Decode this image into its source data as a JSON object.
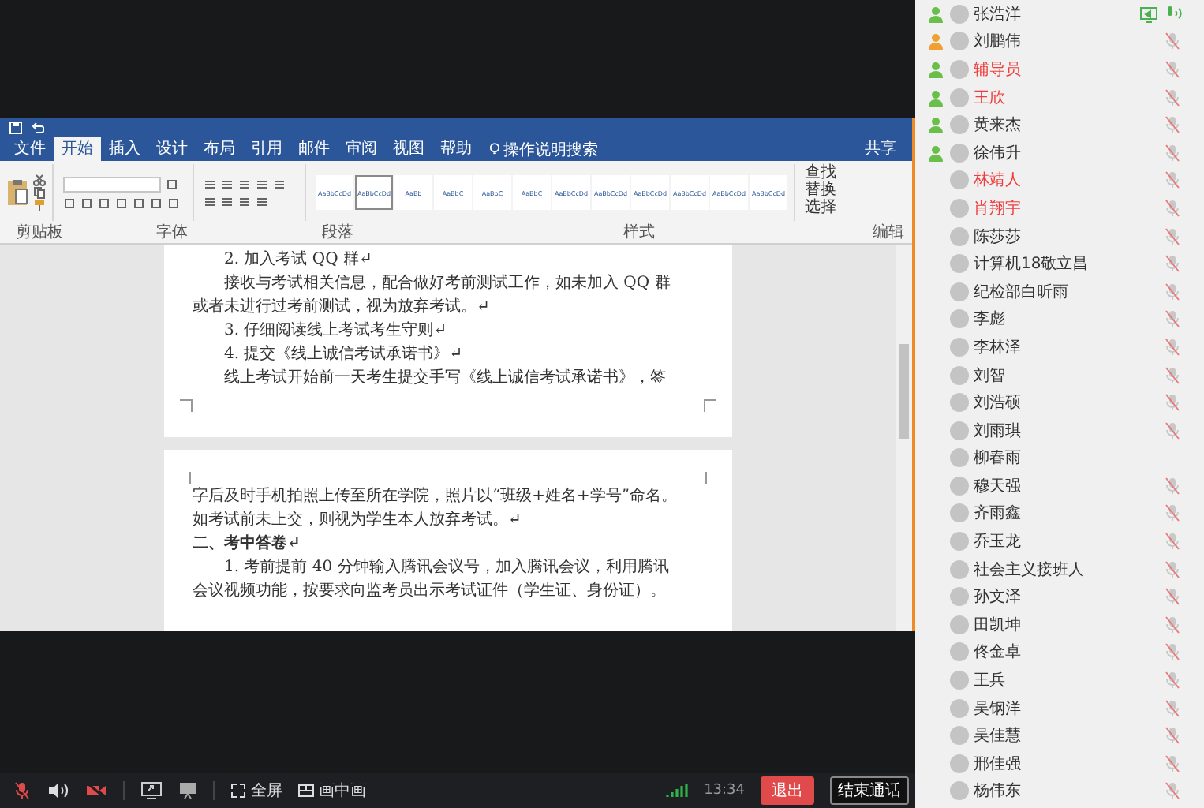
{
  "word": {
    "tabs": [
      {
        "label": "文件",
        "selected": false
      },
      {
        "label": "开始",
        "selected": true
      },
      {
        "label": "插入",
        "selected": false
      },
      {
        "label": "设计",
        "selected": false
      },
      {
        "label": "布局",
        "selected": false
      },
      {
        "label": "引用",
        "selected": false
      },
      {
        "label": "邮件",
        "selected": false
      },
      {
        "label": "审阅",
        "selected": false
      },
      {
        "label": "视图",
        "selected": false
      },
      {
        "label": "帮助",
        "selected": false
      }
    ],
    "tell_me": "操作说明搜索",
    "share": "共享",
    "styles": [
      {
        "preview": "AaBbCcDd",
        "selected": false
      },
      {
        "preview": "AaBbCcDd",
        "selected": true
      },
      {
        "preview": "AaBb",
        "selected": false
      },
      {
        "preview": "AaBbC",
        "selected": false
      },
      {
        "preview": "AaBbC",
        "selected": false
      },
      {
        "preview": "AaBbC",
        "selected": false
      },
      {
        "preview": "AaBbCcDd",
        "selected": false
      },
      {
        "preview": "AaBbCcDd",
        "selected": false
      },
      {
        "preview": "AaBbCcDd",
        "selected": false
      },
      {
        "preview": "AaBbCcDd",
        "selected": false
      },
      {
        "preview": "AaBbCcDd",
        "selected": false
      },
      {
        "preview": "AaBbCcDd",
        "selected": false
      }
    ],
    "editing": [
      "查找",
      "替换",
      "选择"
    ],
    "groups": [
      "剪贴板",
      "字体",
      "段落",
      "样式",
      "编辑"
    ],
    "pages": [
      {
        "lines": [
          {
            "kind": "indent",
            "text": "2. 加入考试 QQ 群↵"
          },
          {
            "kind": "indent",
            "text": "接收与考试相关信息，配合做好考前测试工作，如未加入 QQ 群"
          },
          {
            "kind": "plain",
            "text": "或者未进行过考前测试，视为放弃考试。↵"
          },
          {
            "kind": "indent",
            "text": "3. 仔细阅读线上考试考生守则↵"
          },
          {
            "kind": "indent",
            "text": "4. 提交《线上诚信考试承诺书》↵"
          },
          {
            "kind": "indent",
            "text": "线上考试开始前一天考生提交手写《线上诚信考试承诺书》，签"
          }
        ]
      },
      {
        "lines": [
          {
            "kind": "plain",
            "text": "字后及时手机拍照上传至所在学院，照片以“班级+姓名+学号”命名。"
          },
          {
            "kind": "plain",
            "text": "如考试前未上交，则视为学生本人放弃考试。↵"
          },
          {
            "kind": "heading",
            "text": "二、考中答卷↵"
          },
          {
            "kind": "indent",
            "text": "1. 考前提前 40 分钟输入腾讯会议号，加入腾讯会议，利用腾讯"
          },
          {
            "kind": "plain",
            "text": "会议视频功能，按要求向监考员出示考试证件（学生证、身份证）。"
          }
        ]
      }
    ]
  },
  "toolbar": {
    "mic_muted": true,
    "camera_off": true,
    "fullscreen": "全屏",
    "pip": "画中画",
    "time": "13:34",
    "leave": "退出",
    "end": "结束通话"
  },
  "participants": [
    {
      "name": "张浩洋",
      "color": "#6abf4b",
      "highlighted": false,
      "kind": "speaking",
      "sharing": true
    },
    {
      "name": "刘鹏伟",
      "color": "#f0a030",
      "highlighted": false,
      "kind": "muted",
      "sharing": false
    },
    {
      "name": "辅导员",
      "color": "#6abf4b",
      "highlighted": true,
      "kind": "muted",
      "sharing": false
    },
    {
      "name": "王欣",
      "color": "#6abf4b",
      "highlighted": true,
      "kind": "muted",
      "sharing": false
    },
    {
      "name": "黄来杰",
      "color": "#6abf4b",
      "highlighted": false,
      "kind": "muted",
      "sharing": false
    },
    {
      "name": "徐伟升",
      "color": "#6abf4b",
      "highlighted": false,
      "kind": "muted",
      "sharing": false
    },
    {
      "name": "林靖人",
      "highlighted": true,
      "kind": "muted",
      "sharing": false
    },
    {
      "name": "肖翔宇",
      "highlighted": true,
      "kind": "muted",
      "sharing": false
    },
    {
      "name": "陈莎莎",
      "highlighted": false,
      "kind": "muted",
      "sharing": false
    },
    {
      "name": "计算机18敬立昌",
      "highlighted": false,
      "kind": "muted",
      "sharing": false
    },
    {
      "name": "纪检部白昕雨",
      "highlighted": false,
      "kind": "muted",
      "sharing": false
    },
    {
      "name": "李彪",
      "highlighted": false,
      "kind": "muted",
      "sharing": false
    },
    {
      "name": "李林泽",
      "highlighted": false,
      "kind": "muted",
      "sharing": false
    },
    {
      "name": "刘智",
      "highlighted": false,
      "kind": "muted",
      "sharing": false
    },
    {
      "name": "刘浩硕",
      "highlighted": false,
      "kind": "muted",
      "sharing": false
    },
    {
      "name": "刘雨琪",
      "highlighted": false,
      "kind": "muted",
      "sharing": false
    },
    {
      "name": "柳春雨",
      "highlighted": false,
      "kind": "silent",
      "sharing": false
    },
    {
      "name": "穆天强",
      "highlighted": false,
      "kind": "muted",
      "sharing": false
    },
    {
      "name": "齐雨鑫",
      "highlighted": false,
      "kind": "muted",
      "sharing": false
    },
    {
      "name": "乔玉龙",
      "highlighted": false,
      "kind": "muted",
      "sharing": false
    },
    {
      "name": "社会主义接班人",
      "highlighted": false,
      "kind": "muted",
      "sharing": false
    },
    {
      "name": "孙文泽",
      "highlighted": false,
      "kind": "muted",
      "sharing": false
    },
    {
      "name": "田凯坤",
      "highlighted": false,
      "kind": "muted",
      "sharing": false
    },
    {
      "name": "佟金卓",
      "highlighted": false,
      "kind": "muted",
      "sharing": false
    },
    {
      "name": "王兵",
      "highlighted": false,
      "kind": "muted",
      "sharing": false
    },
    {
      "name": "吴钢洋",
      "highlighted": false,
      "kind": "muted",
      "sharing": false
    },
    {
      "name": "吴佳慧",
      "highlighted": false,
      "kind": "muted",
      "sharing": false
    },
    {
      "name": "邢佳强",
      "highlighted": false,
      "kind": "muted",
      "sharing": false
    },
    {
      "name": "杨伟东",
      "highlighted": false,
      "kind": "muted",
      "sharing": false
    }
  ]
}
